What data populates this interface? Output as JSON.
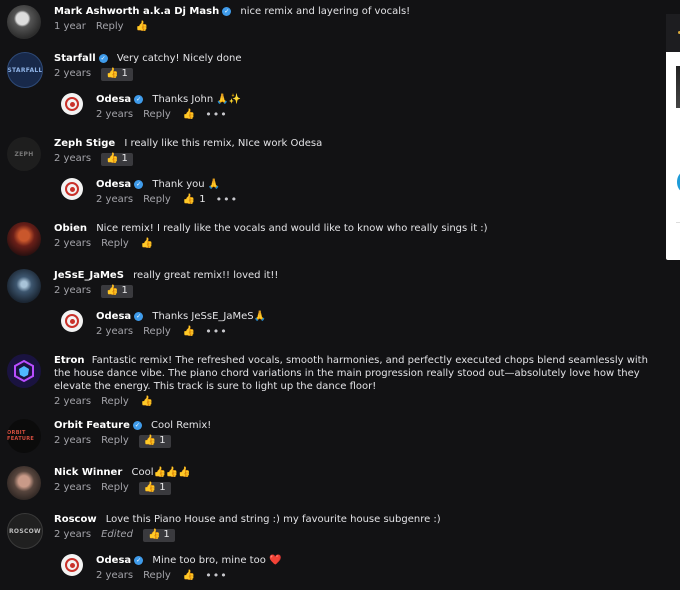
{
  "reply_label": "Reply",
  "comments": [
    {
      "id": "mark",
      "user": "Mark Ashworth a.k.a Dj Mash",
      "verified": true,
      "avatar_icon": "dj-avatar",
      "text": "nice remix and layering of vocals!",
      "time": "1 year",
      "likes": null
    },
    {
      "id": "starfall",
      "user": "Starfall",
      "verified": true,
      "avatar_text": "STARFALL",
      "text": "Very catchy! Nicely done",
      "time": "2 years",
      "likes": "1",
      "reply": {
        "user": "Odesa",
        "verified": true,
        "text": "Thanks John 🙏✨",
        "time": "2 years",
        "likes": null
      }
    },
    {
      "id": "zeph",
      "user": "Zeph Stige",
      "verified": false,
      "avatar_text": "ZEPH",
      "text": "I really like this remix, NIce work Odesa",
      "time": "2 years",
      "likes": "1",
      "reply": {
        "user": "Odesa",
        "verified": true,
        "text": "Thank you 🙏",
        "time": "2 years",
        "likes": "1"
      }
    },
    {
      "id": "obien",
      "user": "Obien",
      "verified": false,
      "text": "Nice remix! I really like the vocals and would like to know who really sings it :)",
      "time": "2 years",
      "likes": null
    },
    {
      "id": "jesse",
      "user": "JeSsE_JaMeS",
      "verified": false,
      "text": "really great remix!! loved it!!",
      "time": "2 years",
      "likes": "1",
      "reply": {
        "user": "Odesa",
        "verified": true,
        "text": "Thanks JeSsE_JaMeS🙏",
        "time": "2 years",
        "likes": null
      }
    },
    {
      "id": "etron",
      "user": "Etron",
      "verified": false,
      "text": "Fantastic remix! The refreshed vocals, smooth harmonies, and perfectly executed chops blend seamlessly with the house dance vibe. The piano chord variations in the main progression really stood out—absolutely love how they elevate the energy. This track is sure to light up the dance floor!",
      "time": "2 years",
      "likes": null
    },
    {
      "id": "orbit",
      "user": "Orbit Feature",
      "verified": true,
      "avatar_text": "ORBIT FEATURE",
      "text": "Cool Remix!",
      "time": "2 years",
      "likes": "1"
    },
    {
      "id": "nick",
      "user": "Nick Winner",
      "verified": false,
      "text": "Cool👍👍👍",
      "time": "2 years",
      "likes": "1"
    },
    {
      "id": "roscow",
      "user": "Roscow",
      "verified": false,
      "avatar_text": "ROSCOW",
      "text": "Love this Piano House and string :) my favourite house subgenre :)",
      "time": "2 years",
      "edited": "Edited",
      "likes": "1",
      "reply": {
        "user": "Odesa",
        "verified": true,
        "text": "Mine too bro, mine too ❤️",
        "time": "2 years",
        "likes": null
      }
    }
  ]
}
